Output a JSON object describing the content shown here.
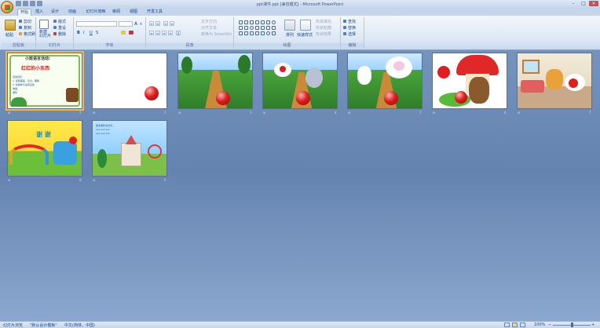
{
  "window": {
    "title": "ppt课件.ppt [兼容模式] - Microsoft PowerPoint"
  },
  "tabs": [
    "开始",
    "插入",
    "设计",
    "动画",
    "幻灯片放映",
    "审阅",
    "视图",
    "开发工具"
  ],
  "ribbon": {
    "clipboard": {
      "paste": "粘贴",
      "cut": "剪切",
      "copy": "复制",
      "format_painter": "格式刷",
      "group": "剪贴板"
    },
    "slides": {
      "new_slide": "新建\n幻灯片",
      "layout": "版式",
      "reset": "重设",
      "delete": "删除",
      "group": "幻灯片"
    },
    "font": {
      "grow": "A",
      "shrink": "A",
      "clear": "A",
      "bold": "B",
      "italic": "I",
      "underline": "U",
      "strike": "S",
      "group": "字体"
    },
    "paragraph": {
      "text_direction": "文字方向",
      "align_text": "对齐文本",
      "smartart": "转换为 SmartArt",
      "group": "段落"
    },
    "drawing": {
      "arrange": "排列",
      "quick_styles": "快速样式",
      "fill": "形状填充",
      "outline": "形状轮廓",
      "effects": "形状效果",
      "group": "绘图"
    },
    "editing": {
      "find": "查找",
      "replace": "替换",
      "select": "选择",
      "group": "编辑"
    }
  },
  "slides": [
    {
      "number": "1",
      "title_text": "小班语言活动：",
      "subtitle_text": "红红的小东西",
      "body_lines": [
        "活动目标：",
        "1. 感知图画，比对、理解",
        "2. 积极参与说话活动",
        "准备：",
        "课件"
      ]
    },
    {
      "number": "2"
    },
    {
      "number": "3"
    },
    {
      "number": "4"
    },
    {
      "number": "5"
    },
    {
      "number": "6"
    },
    {
      "number": "7"
    },
    {
      "number": "8",
      "title_text": "谢 谢"
    },
    {
      "number": "9",
      "body_lines": [
        "更多课件请访问...",
        "xxx.xxx.xxx",
        "xxx.xxx.xxx"
      ]
    }
  ],
  "status": {
    "view": "幻灯片浏览",
    "theme": "\"默认设计模板\"",
    "language": "中文(简体，中国)",
    "zoom": "100%"
  },
  "colors": {
    "accent_red": "#e01e1e",
    "ribbon_blue": "#15428b",
    "background": "#6f8fb8"
  }
}
